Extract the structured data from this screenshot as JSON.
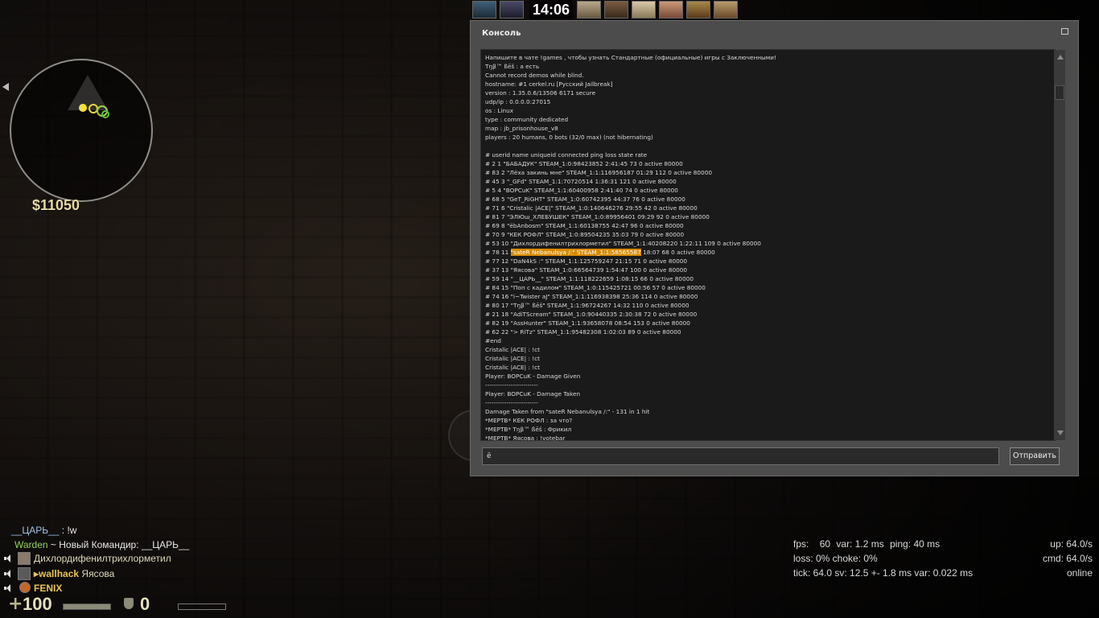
{
  "hud": {
    "money": "$11050",
    "timer": "14:06",
    "health": "100",
    "armor": "0"
  },
  "console": {
    "title": "Консоль",
    "input_value": "ё",
    "send_label": "Отправить",
    "lines": [
      "Напишите в чате !games , чтобы узнать Стандартные (официальные) игры с Заключенными!",
      "Tŋβ™ ßēš : a     есть",
      "Cannot record demos while blind.",
      "hostname: #1 cerkel.ru [Русский Jailbreak]",
      "version : 1.35.0.6/13506 6171 secure",
      "udp/ip  : 0.0.0.0:27015",
      "os      :  Linux",
      "type    :  community dedicated",
      "map     : jb_prisonhouse_v8",
      "players : 20 humans, 0 bots (32/0 max) (not hibernating)",
      "",
      "# userid name uniqueid connected ping loss state rate",
      "#   2 1 \"БАБАДУК\" STEAM_1:0:98423852  2:41:45 73 0 active 80000",
      "# 83 2 \"Лёха закинь мне\" STEAM_1:1:116956187 01:29 112 0 active 80000",
      "# 45 3 \"_GFd\" STEAM_1:1:70720514  1:36:31 121 0 active 80000",
      "#   5 4 \"BOPCuK\" STEAM_1:1:60400958  2:41:40 74 0 active 80000",
      "# 68 5 \"GeT_RiGHT\" STEAM_1:0:60742395 44:37 76 0 active 80000",
      "# 71 6 \"Cristalic |ACE|\" STEAM_1:0:140646276 29:55 42 0 active 80000",
      "# 81 7 \"ЭЛЮш_ХЛЕБУШЕК\" STEAM_1:0:89956401 09:29 92 0 active 80000",
      "# 69 8 \"ёbAnbosm\" STEAM_1:1:60138755 42:47 96 0 active 80000",
      "# 70 9 \"КЕК РОФЛ\" STEAM_1:0:89504235 35:03 79 0 active 80000",
      "# 53 10 \"Дихлордифенилтрихлорметил\" STEAM_1:1:40208220  1:22:11 109 0 active 80000",
      "# 78 11 \"sateR Nebanulsya /:\" STEAM_1:1:58565587 18:07 68 0 active 80000",
      "# 77 12 \"DaN4kS :\" STEAM_1:1:125759247 21:15 71 0 active 80000",
      "# 37 13 \"Яясова\" STEAM_1:0:66564739  1:54:47 100 0 active 80000",
      "# 59 14 \"__ЦАРЬ__\" STEAM_1:1:118222659  1:08:15 66 0 active 80000",
      "# 84 15 \"Поп с кадилом\" STEAM_1:0:115425721 00:56 57 0 active 80000",
      "# 74 16 \"i~Twister aJ\" STEAM_1:1:116938398 25:36 114 0 active 80000",
      "# 80 17 \"Tŋβ™ ßēš\" STEAM_1:1:96724267 14:32 110 0 active 80000",
      "# 21 18 \"AdiTScream\" STEAM_1:0:90440335  2:30:38 72 0 active 80000",
      "# 82 19 \"AssHunter\" STEAM_1:1:93658078 08:54 153 0 active 80000",
      "# 62 22 \"> RiTz\" STEAM_1:1:95482308  1:02:03 89 0 active 80000",
      "#end",
      "Cristalic |ACE| : !ct",
      "Cristalic |ACE| : !ct",
      "Cristalic |ACE| : !ct",
      "Player: BOPCuK - Damage Given",
      "-------------------------",
      "Player: BOPCuK - Damage Taken",
      "-------------------------",
      "Damage Taken from \"sateR Nebanulsya /:\" - 131 in 1 hit",
      "*МЕРТВ* КЕК РОФЛ : за что?",
      "*МЕРТВ* Tŋβ™ ßēš : Фрикил",
      "*МЕРТВ* Яясова : !votebar"
    ],
    "highlight": {
      "line_index": 22,
      "before": "# 78 11 ",
      "marked": "\"sateR Nebanulsya /:\" STEAM_1:1:58565587",
      "after": " 18:07 68 0 active 80000"
    }
  },
  "chat": {
    "line1_name": "__ЦАРЬ__",
    "line1_text": " : !w",
    "line2_prefix": "Warden",
    "line2_text": " ~ Новый Командир: __ЦАРЬ__",
    "voice": [
      {
        "prefix": "",
        "name": "Дихлордифенилтрихлорметил"
      },
      {
        "prefix": "▸wallhack",
        "name": " Яясова"
      },
      {
        "prefix": "",
        "name": "FENIX"
      }
    ]
  },
  "netgraph": {
    "fps_label": "fps:",
    "fps": "60",
    "var_label": "var:",
    "var": "1.2 ms",
    "ping_label": "ping:",
    "ping": "40 ms",
    "loss_line": "loss:   0%  choke:  0%",
    "tick_line": "tick: 64.0  sv: 12.5 +- 1.8 ms   var:  0.022 ms",
    "up": "up: 64.0/s",
    "cmd": "cmd: 64.0/s",
    "online": "online"
  },
  "colors": {
    "highlight": "#d78a00",
    "warden": "#8fd15a",
    "voice_prefix": "#e7c25a",
    "money": "#e7d9a4"
  }
}
